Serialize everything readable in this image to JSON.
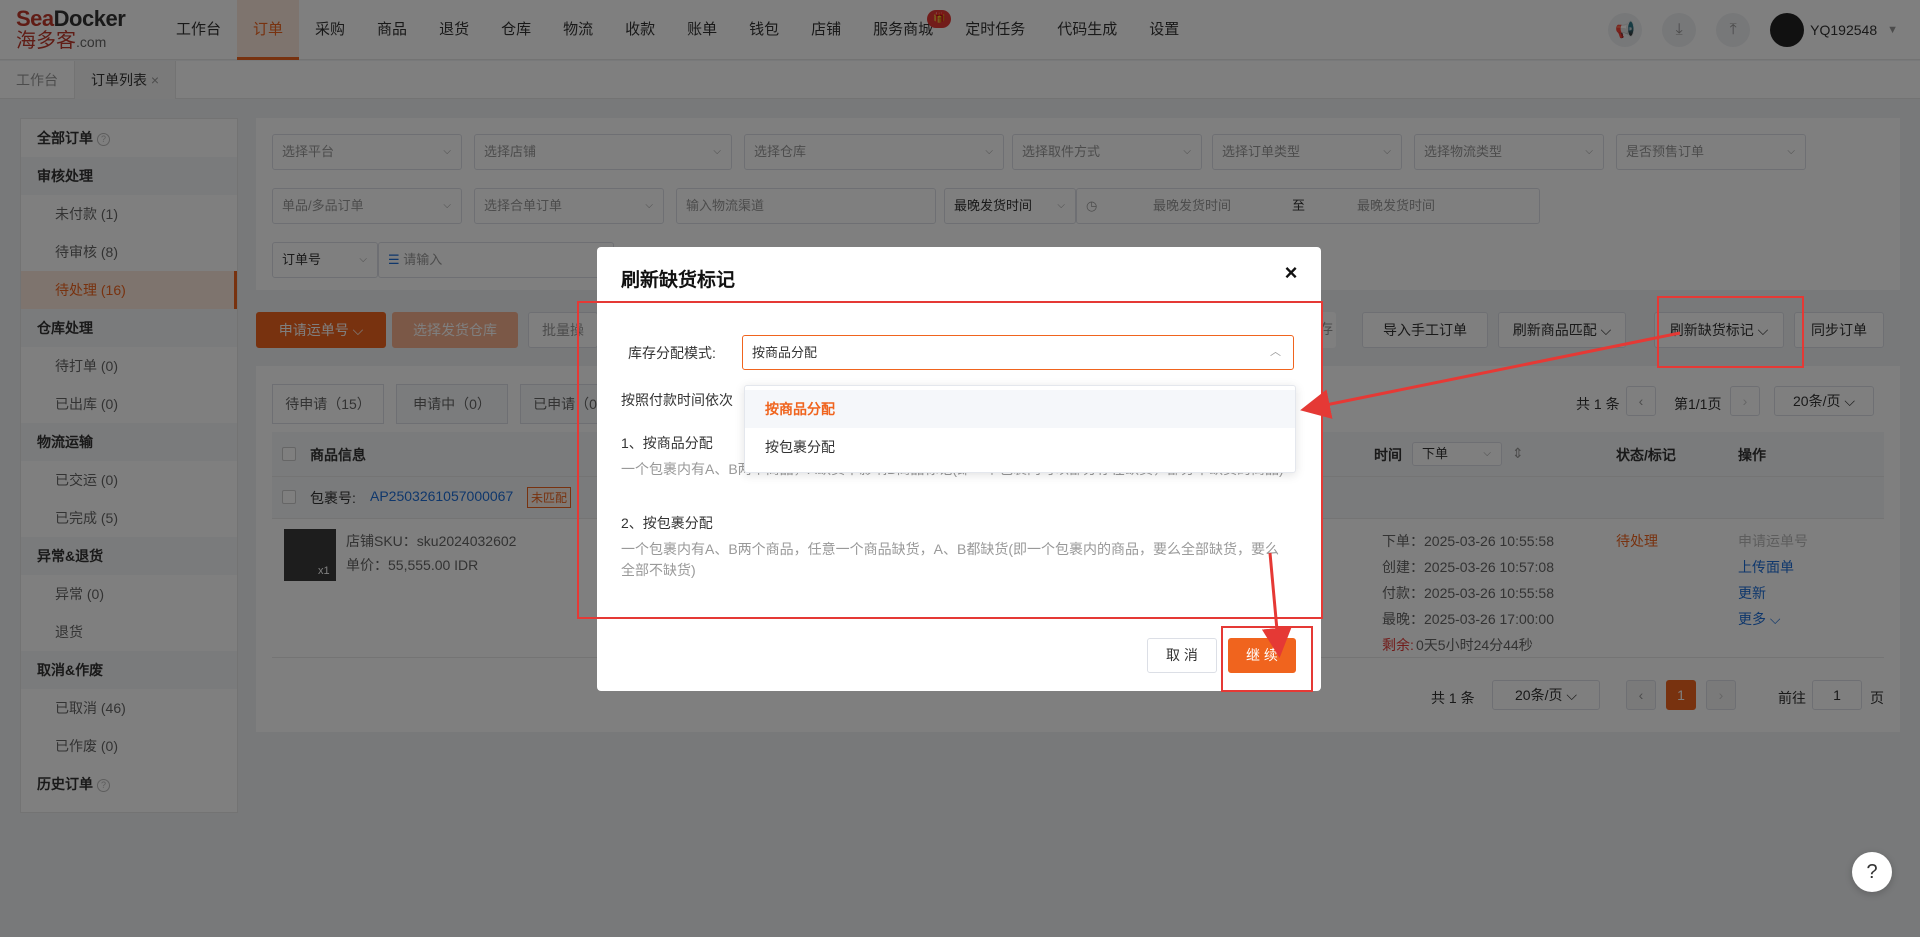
{
  "logo": {
    "brand_a": "Sea",
    "brand_b": "Docker",
    "brand_cn": "海多客",
    "brand_suffix": ".com"
  },
  "nav": {
    "items": [
      "工作台",
      "订单",
      "采购",
      "商品",
      "退货",
      "仓库",
      "物流",
      "收款",
      "账单",
      "钱包",
      "店铺",
      "服务商城",
      "定时任务",
      "代码生成",
      "设置"
    ],
    "active_index": 1
  },
  "user": {
    "name": "YQ192548"
  },
  "tabs": {
    "home": "工作台",
    "current": "订单列表",
    "close": "×"
  },
  "sidebar": {
    "all_orders": "全部订单",
    "groups": {
      "review": "审核处理",
      "warehouse": "仓库处理",
      "logistics": "物流运输",
      "exception": "异常&退货",
      "cancel": "取消&作废",
      "history": "历史订单"
    },
    "items": {
      "unpaid": "未付款 (1)",
      "pending_review": "待审核 (8)",
      "pending_process": "待处理 (16)",
      "pending_print": "待打单 (0)",
      "shipped_out": "已出库 (0)",
      "delivered": "已交运 (0)",
      "completed": "已完成 (5)",
      "exception": "异常 (0)",
      "returned": "退货",
      "cancelled": "已取消 (46)",
      "voided": "已作废 (0)"
    }
  },
  "filters": {
    "platform": "选择平台",
    "store": "选择店铺",
    "warehouse": "选择仓库",
    "pickup": "选择取件方式",
    "order_type": "选择订单类型",
    "logistics_type": "选择物流类型",
    "presale": "是否预售订单",
    "single_multi": "单品/多品订单",
    "merge": "选择合单订单",
    "channel_placeholder": "输入物流渠道",
    "latest_ship": "最晚发货时间",
    "date_start": "最晚发货时间",
    "date_sep": "至",
    "date_end": "最晚发货时间",
    "order_no": "订单号",
    "search_placeholder": "请输入"
  },
  "toolbar": {
    "apply_tracking": "申请运单号",
    "select_warehouse": "选择发货仓库",
    "batch": "批量操",
    "save_partial": "存",
    "import_manual": "导入手工订单",
    "refresh_match": "刷新商品匹配",
    "refresh_stock": "刷新缺货标记",
    "sync_orders": "同步订单"
  },
  "status_tabs": [
    "待申请（15）",
    "申请中（0）",
    "已申请（0"
  ],
  "pagination_top": {
    "total": "共 1 条",
    "page": "第1/1页",
    "per_page": "20条/页"
  },
  "table": {
    "col_product": "商品信息",
    "col_time": "时间",
    "time_select": "下单",
    "col_status": "状态/标记",
    "col_action": "操作"
  },
  "package": {
    "label": "包裹号:",
    "id": "AP2503261057000067",
    "tag": "未匹配"
  },
  "product": {
    "qty": "x1",
    "sku": "店铺SKU：sku2024032602",
    "price": "单价：55,555.00 IDR",
    "times": [
      "下单：2025-03-26 10:55:58",
      "创建：2025-03-26 10:57:08",
      "付款：2025-03-26 10:55:58",
      "最晚：2025-03-26 17:00:00"
    ],
    "remaining_label": "剩余:",
    "remaining_value": "0天5小时24分44秒",
    "status": "待处理",
    "actions": [
      "申请运单号",
      "上传面单",
      "更新",
      "更多"
    ]
  },
  "pagination_bottom": {
    "total": "共 1 条",
    "per_page": "20条/页",
    "page": "1",
    "goto": "前往",
    "goto_value": "1",
    "page_unit": "页"
  },
  "modal": {
    "title": "刷新缺货标记",
    "close": "×",
    "label": "库存分配模式:",
    "value": "按商品分配",
    "desc_line": "按照付款时间依次",
    "opt1_title": "1、按商品分配",
    "opt1_desc": "一个包裹内有A、B两个商品，A缺货不影响B商品标记(即一个包裹内可以部分存在缺货，部分不缺货的商品)",
    "opt2_title": "2、按包裹分配",
    "opt2_desc": "一个包裹内有A、B两个商品，任意一个商品缺货，A、B都缺货(即一个包裹内的商品，要么全部缺货，要么全部不缺货)",
    "cancel": "取 消",
    "ok": "继 续"
  },
  "dropdown": {
    "options": [
      "按商品分配",
      "按包裹分配"
    ],
    "selected_index": 0
  },
  "colors": {
    "accent": "#f0641e",
    "annotation": "#e53935",
    "link": "#1e6fd9"
  }
}
